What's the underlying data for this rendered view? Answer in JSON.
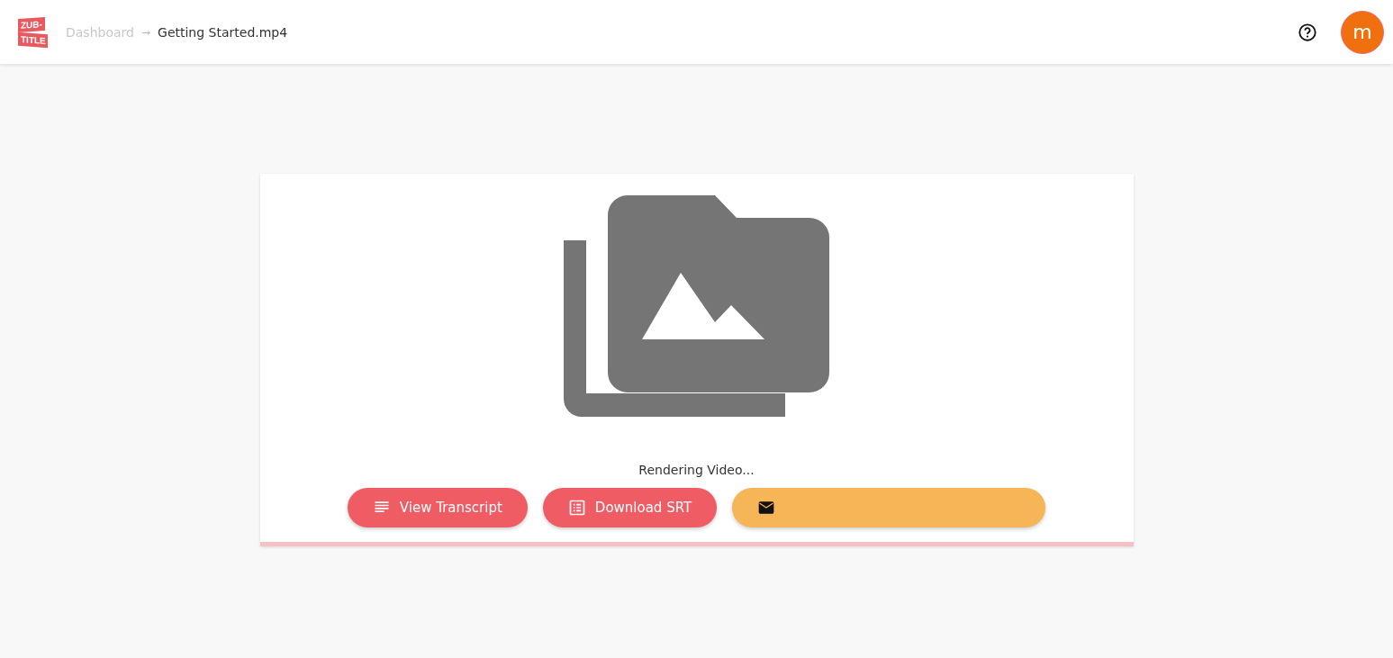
{
  "header": {
    "logo": [
      "ZUB-",
      "TITLE"
    ],
    "breadcrumb": [
      {
        "label": "Dashboard",
        "current": false
      },
      {
        "label": "Getting Started.mp4",
        "current": true
      }
    ],
    "breadcrumb_separator": "→",
    "avatar": "m"
  },
  "card": {
    "status": "Rendering Video...",
    "buttons": [
      {
        "kind": "transcript",
        "label": "View Transcript"
      },
      {
        "kind": "srt",
        "label": "Download SRT"
      },
      {
        "kind": "email"
      }
    ]
  }
}
